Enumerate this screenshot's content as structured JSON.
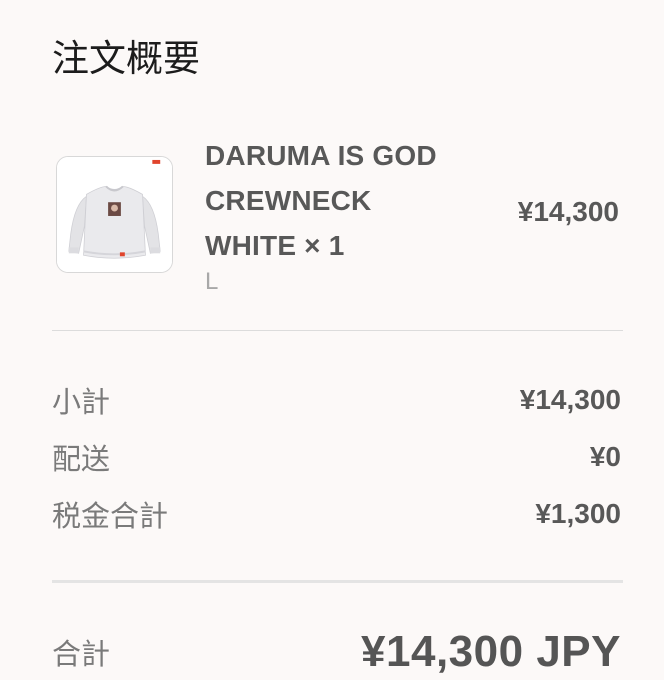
{
  "header": {
    "title": "注文概要"
  },
  "item": {
    "name_line1": "DARUMA IS GOD",
    "name_line2": "CREWNECK",
    "name_line3": "WHITE × 1",
    "variant": "L",
    "price": "¥14,300",
    "image_icon": "crewneck-sweatshirt-thumbnail"
  },
  "summary": {
    "subtotal_label": "小計",
    "subtotal_value": "¥14,300",
    "shipping_label": "配送",
    "shipping_value": "¥0",
    "tax_label": "税金合計",
    "tax_value": "¥1,300"
  },
  "total": {
    "label": "合計",
    "value": "¥14,300 JPY"
  },
  "colors": {
    "background": "#fcf9f8",
    "text_dark": "#1c1c1c",
    "text_mid": "#585858",
    "text_muted": "#a8a8a8"
  }
}
